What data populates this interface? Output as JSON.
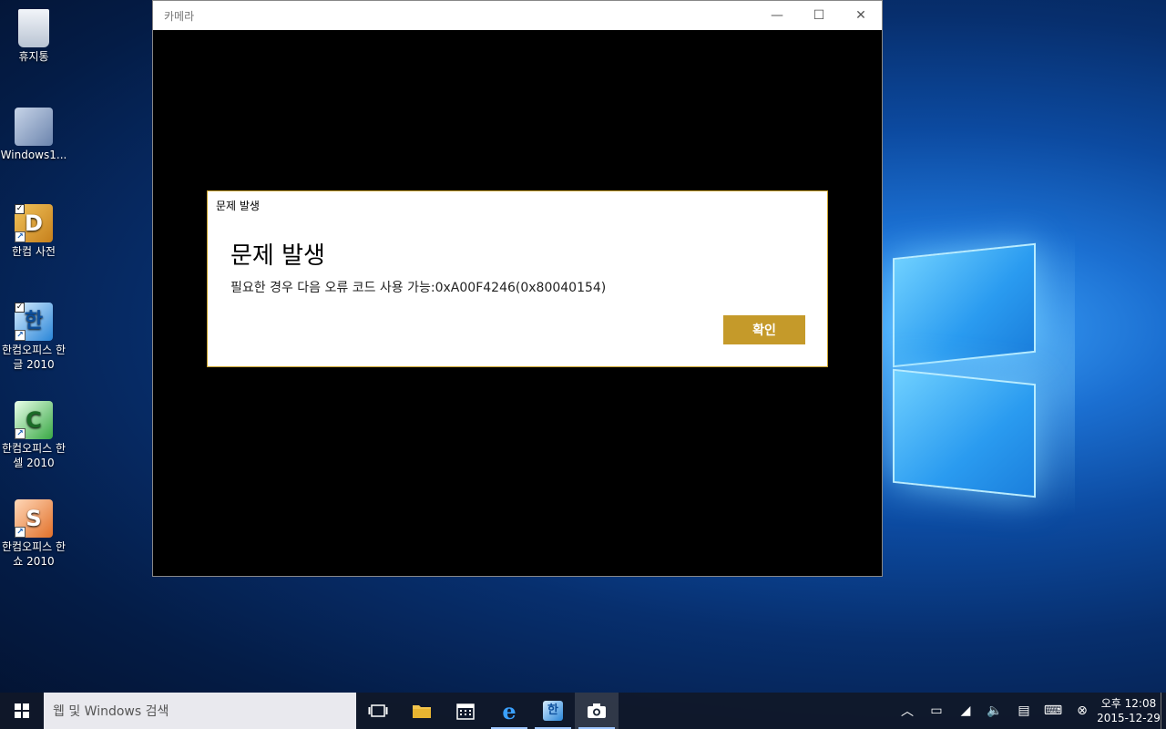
{
  "desktop": {
    "icons": [
      {
        "label": "휴지통",
        "icon": "recycle-bin-icon",
        "color": "#cfd8e6"
      },
      {
        "label": "Windows1...",
        "icon": "windows-setup-icon",
        "color": "#8aa6c9"
      },
      {
        "label": "한컴 사전",
        "icon": "hancom-dictionary-icon",
        "color": "#d89b2a"
      },
      {
        "label": "한컴오피스 한글 2010",
        "icon": "hancom-hangul-icon",
        "color": "#2a86d8"
      },
      {
        "label": "한컴오피스 한셀 2010",
        "icon": "hancom-hancell-icon",
        "color": "#39a845"
      },
      {
        "label": "한컴오피스 한쇼 2010",
        "icon": "hancom-hanshow-icon",
        "color": "#e2712a"
      }
    ]
  },
  "window": {
    "title": "카메라",
    "minimize": "—",
    "maximize": "☐",
    "close": "✕"
  },
  "dialog": {
    "small_title": "문제 발생",
    "title": "문제 발생",
    "message": "필요한 경우 다음 오류 코드 사용 가능:0xA00F4246(0x80040154)",
    "ok_label": "확인",
    "accent": "#c59a2a"
  },
  "taskbar": {
    "search_placeholder": "웹 및 Windows 검색",
    "clock_time": "오후 12:08",
    "clock_date": "2015-12-29"
  }
}
